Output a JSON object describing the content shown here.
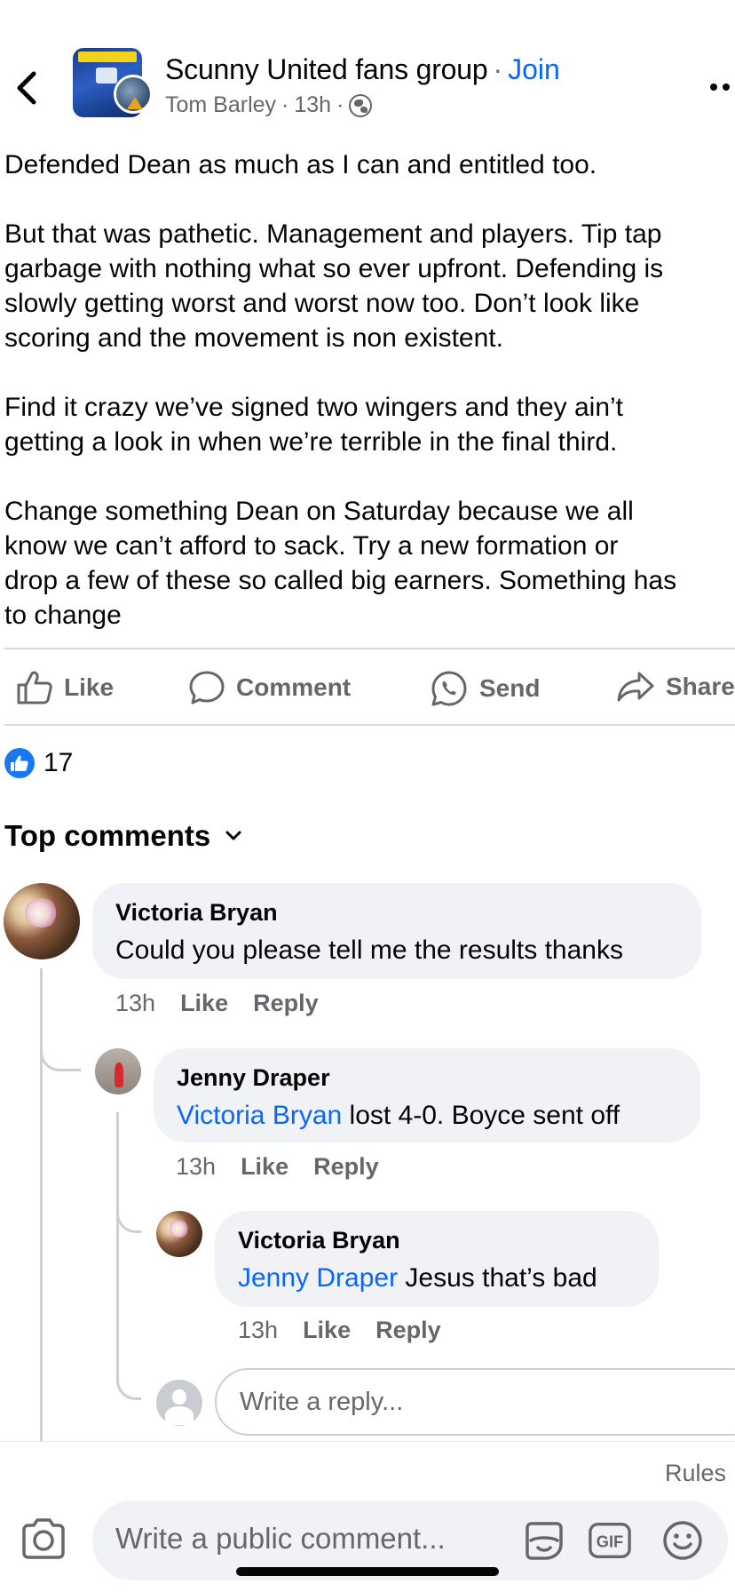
{
  "header": {
    "group_name": "Scunny United fans group",
    "separator": "·",
    "join_label": "Join",
    "author": "Tom Barley",
    "time": "13h",
    "privacy_icon": "globe-icon"
  },
  "post": {
    "paragraphs": [
      [
        "Defended Dean as much as I can and entitled too."
      ],
      [
        "But that was pathetic. Management and players. Tip tap",
        "garbage with nothing what so ever upfront. Defending is",
        "slowly getting worst and worst now too. Don’t look like",
        "scoring and the movement is non existent."
      ],
      [
        "Find it crazy we’ve signed two wingers and they ain’t",
        "getting a look in when we’re terrible in the final third."
      ],
      [
        "Change something Dean on Saturday because we all",
        "know we can’t afford to sack. Try a new formation or",
        "drop a few of these so called big earners. Something has",
        "to change"
      ]
    ]
  },
  "actions": {
    "like": "Like",
    "comment": "Comment",
    "send": "Send",
    "share": "Share"
  },
  "reactions": {
    "count": "17",
    "icon": "thumbs-up-icon",
    "color": "#1877f2"
  },
  "comments_header": {
    "label": "Top comments"
  },
  "comments": [
    {
      "author": "Victoria Bryan",
      "mention": "",
      "text": "Could you please tell me the results thanks",
      "time": "13h",
      "like": "Like",
      "reply": "Reply"
    },
    {
      "author": "Jenny Draper",
      "mention": "Victoria Bryan",
      "text": " lost 4-0. Boyce sent off",
      "time": "13h",
      "like": "Like",
      "reply": "Reply"
    },
    {
      "author": "Victoria Bryan",
      "mention": "Jenny Draper",
      "text": " Jesus that’s bad",
      "time": "13h",
      "like": "Like",
      "reply": "Reply"
    }
  ],
  "reply_input": {
    "placeholder": "Write a reply..."
  },
  "footer": {
    "rules": "Rules",
    "placeholder": "Write a public comment...",
    "gif_label": "GIF"
  },
  "colors": {
    "accent": "#0866ff",
    "muted": "#65676b",
    "bubble": "#f0f2f5"
  }
}
